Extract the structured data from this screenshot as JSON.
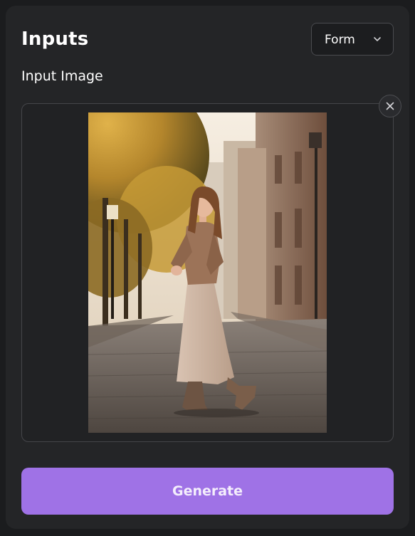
{
  "header": {
    "title": "Inputs",
    "mode_select": {
      "selected": "Form"
    }
  },
  "input_image": {
    "label": "Input Image",
    "close_icon": "close-icon"
  },
  "actions": {
    "generate_label": "Generate"
  },
  "colors": {
    "panel_bg": "#242527",
    "page_bg": "#1b1c1e",
    "accent": "#9f72e6"
  }
}
